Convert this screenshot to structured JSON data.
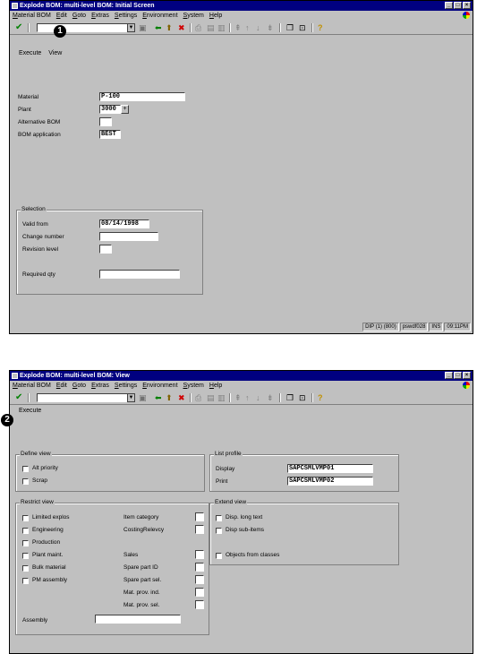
{
  "menu_items": [
    "Material BOM",
    "Edit",
    "Goto",
    "Extras",
    "Settings",
    "Environment",
    "System",
    "Help"
  ],
  "callouts": [
    "1",
    "2"
  ],
  "screen1": {
    "title": "Explode BOM: multi-level BOM: Initial Screen",
    "appbar": [
      "Execute",
      "View"
    ],
    "fields": {
      "material_label": "Material",
      "material_value": "P-100",
      "plant_label": "Plant",
      "plant_value": "3000",
      "alt_bom_label": "Alternative BOM",
      "alt_bom_value": "",
      "bom_app_label": "BOM application",
      "bom_app_value": "BEST"
    },
    "selection": {
      "title": "Selection",
      "valid_from_label": "Valid from",
      "valid_from_value": "08/14/1998",
      "change_number_label": "Change number",
      "change_number_value": "",
      "revision_label": "Revision level",
      "revision_value": "",
      "required_qty_label": "Required qty",
      "required_qty_value": ""
    },
    "status": [
      "DIP (1) (800)",
      "pswdf028",
      "INS",
      "09:11PM"
    ]
  },
  "screen2": {
    "title": "Explode BOM: multi-level BOM: View",
    "appbar": [
      "Execute"
    ],
    "define_view": {
      "title": "Define view",
      "items": [
        {
          "label": "Alt priority",
          "checked": false
        },
        {
          "label": "Scrap",
          "checked": false
        }
      ]
    },
    "list_profile": {
      "title": "List profile",
      "display_label": "Display",
      "display_value": "SAPCSMLVMP01",
      "print_label": "Print",
      "print_value": "SAPCSMLVMP02"
    },
    "restrict_view": {
      "title": "Restrict view",
      "left_items": [
        "Limited explos",
        "Engineering",
        "Production",
        "Plant maint.",
        "Bulk material",
        "PM assembly"
      ],
      "right_items": [
        "Item category",
        "CostingRelevcy",
        "Sales",
        "Spare part ID",
        "Spare part sel.",
        "Mat. prov. ind.",
        "Mat. prov. sel."
      ],
      "assembly_label": "Assembly",
      "assembly_value": ""
    },
    "extend_view": {
      "title": "Extend view",
      "items": [
        "Disp. long text",
        "Disp sub-items",
        "Objects from classes"
      ]
    }
  }
}
